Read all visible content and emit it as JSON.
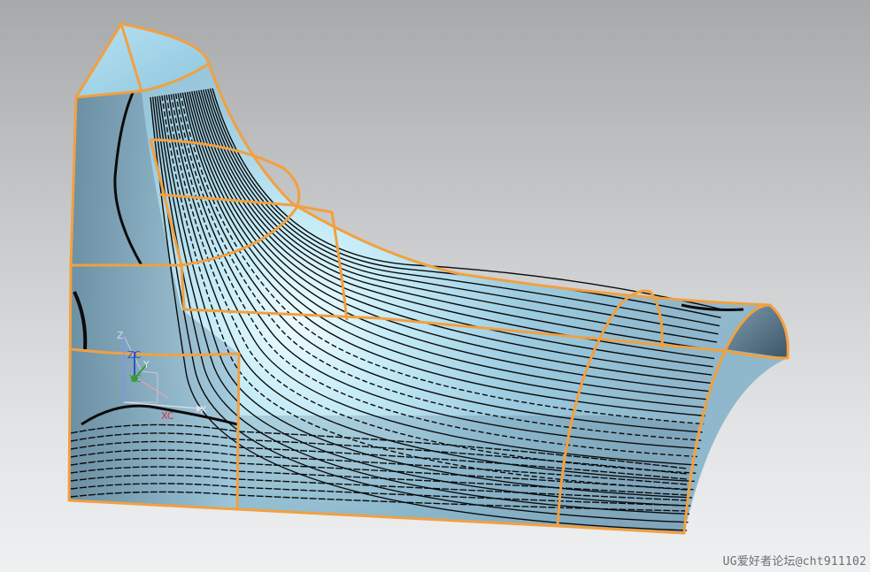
{
  "viewport": {
    "watermark": "UG爱好者论坛@cht911102",
    "triad": {
      "z_label": "Z",
      "x_label": "X",
      "y_label": "Y",
      "xc_label": "XC",
      "zc_label": "ZC",
      "yc_label": "YC"
    }
  },
  "colors": {
    "surface_light": "#e6f8fc",
    "surface_mid": "#a9d4e8",
    "surface_dark": "#5f7f94",
    "edge": "#f2a040",
    "isoline": "#0b0b0b",
    "x_axis": "#d2323c",
    "y_axis": "#3a9a3a",
    "z_axis": "#3050c8"
  }
}
